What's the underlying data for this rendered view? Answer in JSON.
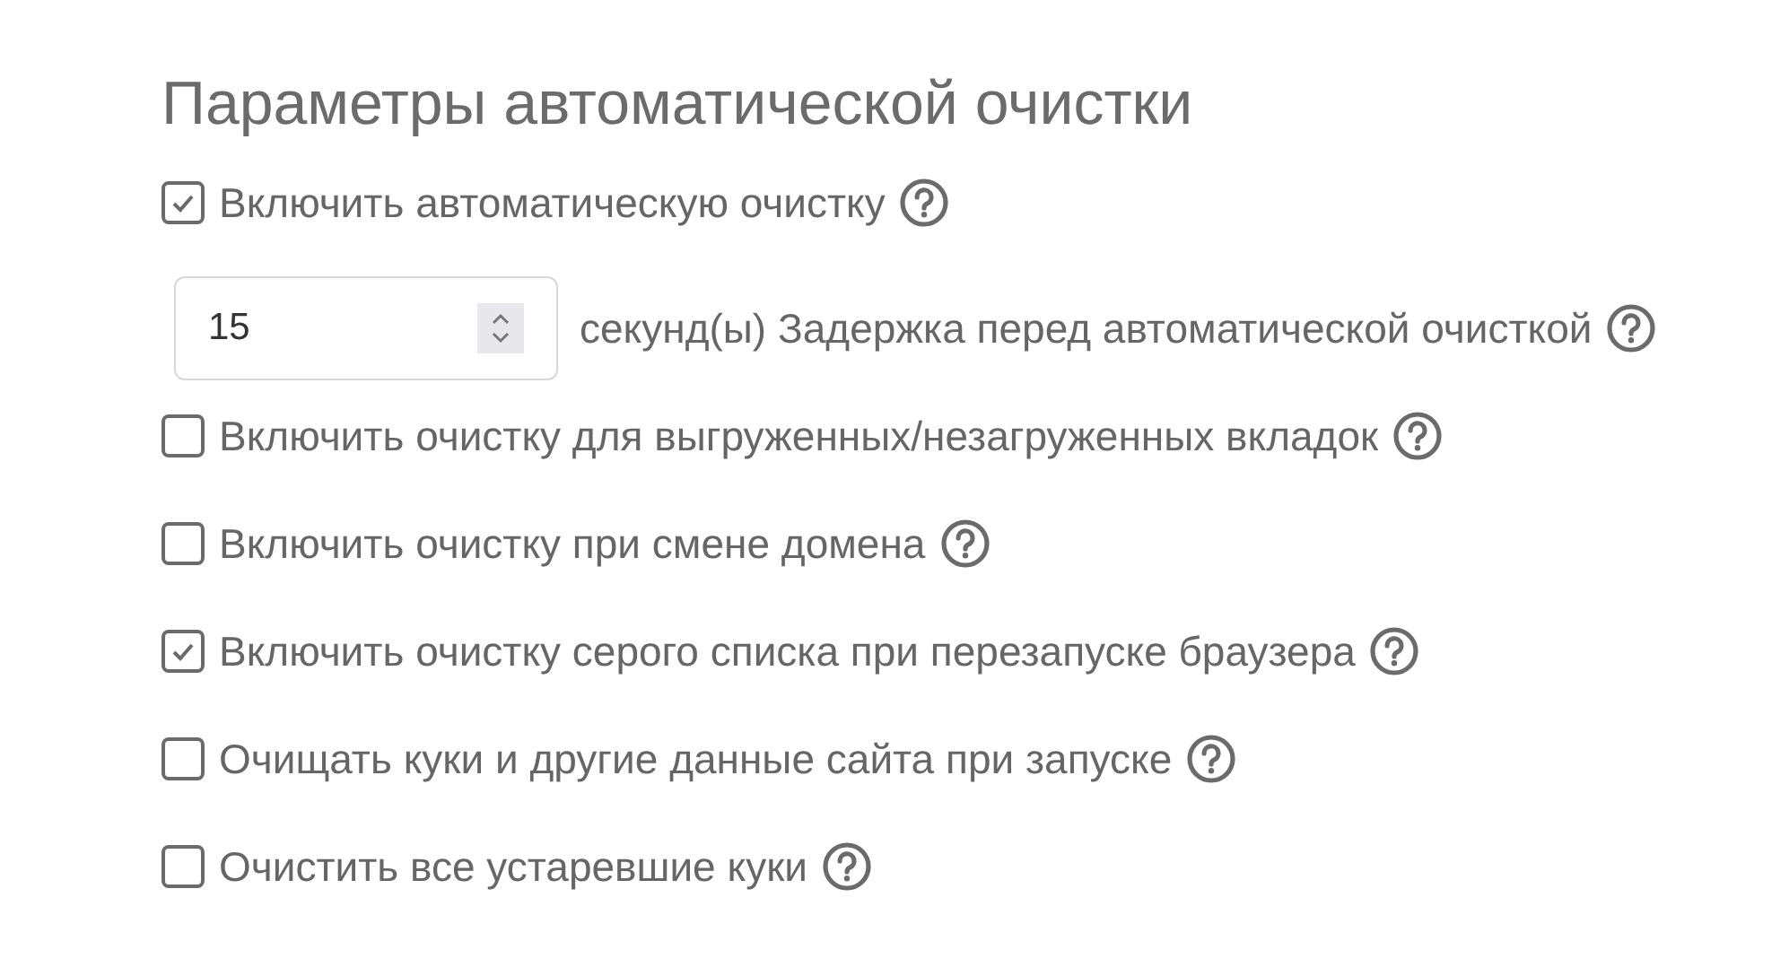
{
  "title": "Параметры автоматической очистки",
  "options": [
    {
      "kind": "checkbox",
      "label": "Включить автоматическую очистку",
      "checked": true
    },
    {
      "kind": "number",
      "value": "15",
      "suffix": "секунд(ы) Задержка перед автоматической очисткой"
    },
    {
      "kind": "checkbox",
      "label": "Включить очистку для выгруженных/незагруженных вкладок",
      "checked": false
    },
    {
      "kind": "checkbox",
      "label": "Включить очистку при смене домена",
      "checked": false
    },
    {
      "kind": "checkbox",
      "label": "Включить очистку серого списка при перезапуске браузера",
      "checked": true
    },
    {
      "kind": "checkbox",
      "label": "Очищать куки и другие данные сайта при запуске",
      "checked": false
    },
    {
      "kind": "checkbox",
      "label": "Очистить все устаревшие куки",
      "checked": false
    }
  ]
}
